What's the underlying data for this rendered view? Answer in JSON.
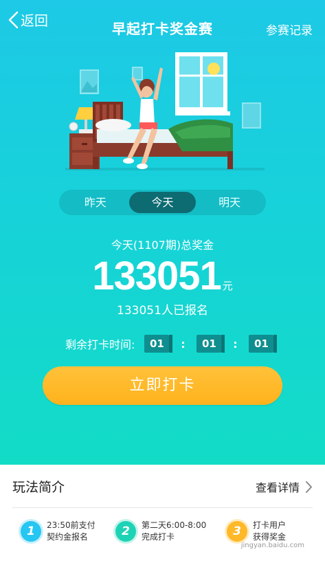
{
  "header": {
    "back_label": "返回",
    "title": "早起打卡奖金赛",
    "records_label": "参赛记录"
  },
  "tabs": [
    {
      "label": "昨天",
      "active": false
    },
    {
      "label": "今天",
      "active": true
    },
    {
      "label": "明天",
      "active": false
    }
  ],
  "prize": {
    "label": "今天(1107期)总奖金",
    "amount": "133051",
    "unit": "元",
    "signed_up": "133051人已报名"
  },
  "countdown": {
    "label": "剩余打卡时间:",
    "hours": "01",
    "minutes": "01",
    "seconds": "01",
    "separator": ":"
  },
  "checkin_button": "立即打卡",
  "rules": {
    "title": "玩法简介",
    "details_label": "查看详情",
    "steps": [
      {
        "number": "1",
        "line1": "23:50前支付",
        "line2": "契约金报名",
        "color": "#26c6f2"
      },
      {
        "number": "2",
        "line1": "第二天6:00-8:00",
        "line2": "完成打卡",
        "color": "#1ed3b5"
      },
      {
        "number": "3",
        "line1": "打卡用户",
        "line2": "获得奖金",
        "color": "#ffb827"
      }
    ],
    "watermark": "jingyan.baidu.com"
  },
  "colors": {
    "bg_top": "#1dc9e6",
    "bg_bottom": "#12dcc6",
    "button": "#ffb21c",
    "tab_active": "#0d6b72"
  }
}
